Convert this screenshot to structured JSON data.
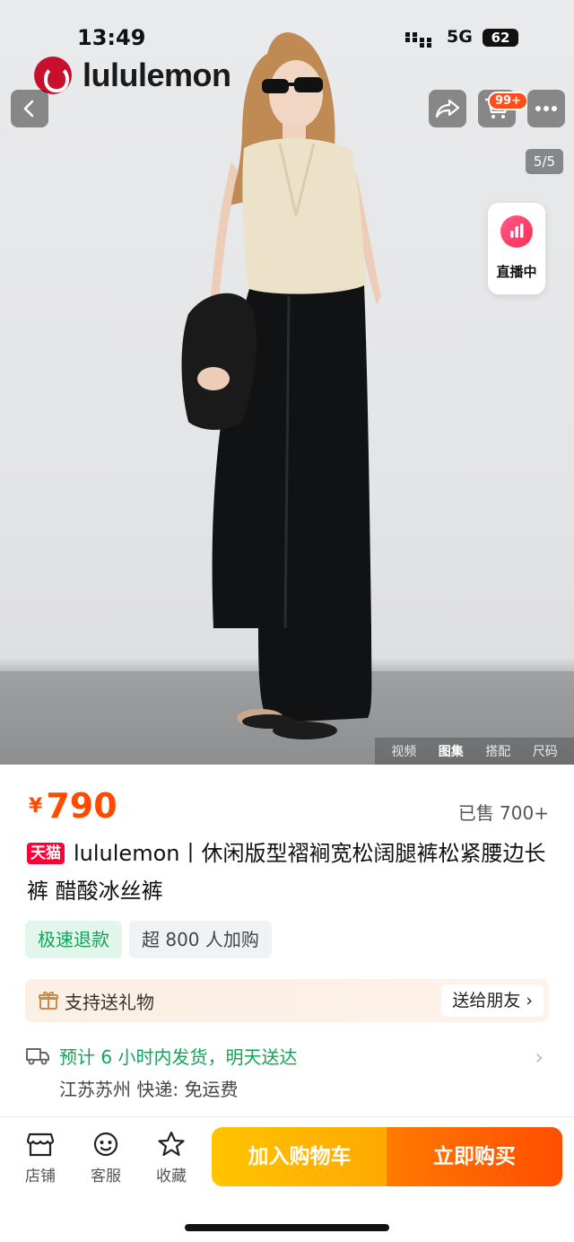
{
  "status": {
    "time": "13:49",
    "network": "5G",
    "battery": "62"
  },
  "brand": {
    "name": "lululemon"
  },
  "header": {
    "cart_badge": "99+",
    "image_counter": "5/5"
  },
  "live": {
    "label": "直播中"
  },
  "media_tabs": [
    "视频",
    "图集",
    "搭配",
    "尺码"
  ],
  "product": {
    "currency": "¥",
    "price": "790",
    "sold": "已售 700+",
    "store_badge": "天猫",
    "title": "lululemon丨休闲版型褶裥宽松阔腿裤松紧腰边长裤  醋酸冰丝裤",
    "tags": [
      "极速退款",
      "超 800 人加购"
    ]
  },
  "gift": {
    "text": "支持送礼物",
    "button": "送给朋友 ›"
  },
  "shipping": {
    "line1": "预计 6 小时内发货，明天送达",
    "line2": "江苏苏州  快递: 免运费"
  },
  "bottom": {
    "store": "店铺",
    "service": "客服",
    "favorite": "收藏",
    "add_to_cart": "加入购物车",
    "buy_now": "立即购买"
  },
  "icons": [
    "back-icon",
    "share-icon",
    "cart-icon",
    "more-icon",
    "live-icon",
    "gift-icon",
    "truck-icon",
    "store-icon",
    "service-icon",
    "star-icon"
  ]
}
